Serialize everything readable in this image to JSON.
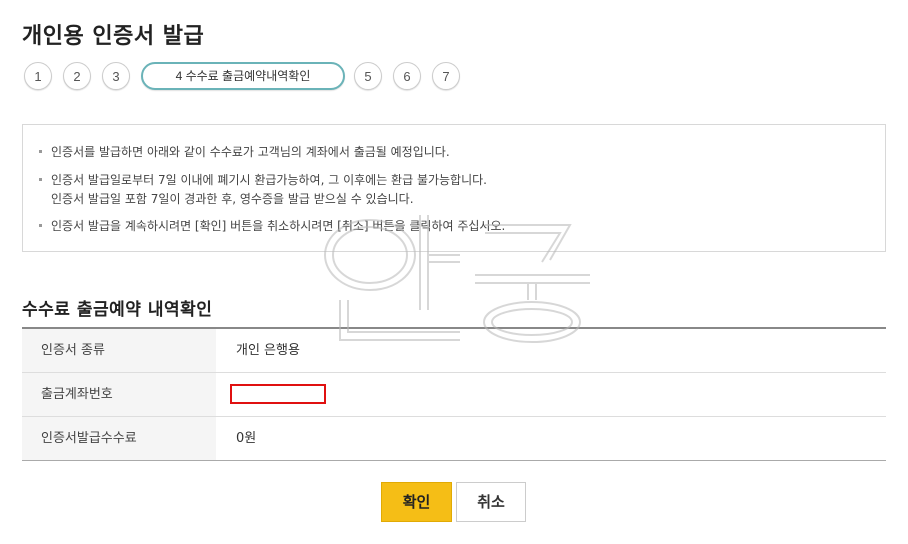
{
  "page": {
    "title": "개인용 인증서 발급"
  },
  "steps": [
    {
      "label": "1"
    },
    {
      "label": "2"
    },
    {
      "label": "3"
    },
    {
      "label": "4 수수료 출금예약내역확인",
      "active": true
    },
    {
      "label": "5"
    },
    {
      "label": "6"
    },
    {
      "label": "7"
    }
  ],
  "notice": {
    "items": [
      "인증서를 발급하면 아래와 같이 수수료가 고객님의 계좌에서 출금될 예정입니다.",
      "인증서 발급일로부터 7일 이내에 폐기시 환급가능하여, 그 이후에는 환급 불가능합니다.",
      "인증서 발급일 포함 7일이 경과한 후, 영수증을 발급 받으실 수 있습니다.",
      "인증서 발급을 계속하시려면 [확인] 버튼을 취소하시려면 [취소] 버튼을 클릭하여 주십시오."
    ]
  },
  "section": {
    "title": "수수료 출금예약 내역확인"
  },
  "table": {
    "rows": [
      {
        "label": "인증서 종류",
        "value": "개인 은행용"
      },
      {
        "label": "출금계좌번호",
        "value": ""
      },
      {
        "label": "인증서발급수수료",
        "value": "0원"
      }
    ]
  },
  "buttons": {
    "ok_label": "확인",
    "cancel_label": "취소"
  },
  "colors": {
    "accent": "#f5be16",
    "step_active_border": "#6ab3b8",
    "redact_border": "#e01010"
  }
}
